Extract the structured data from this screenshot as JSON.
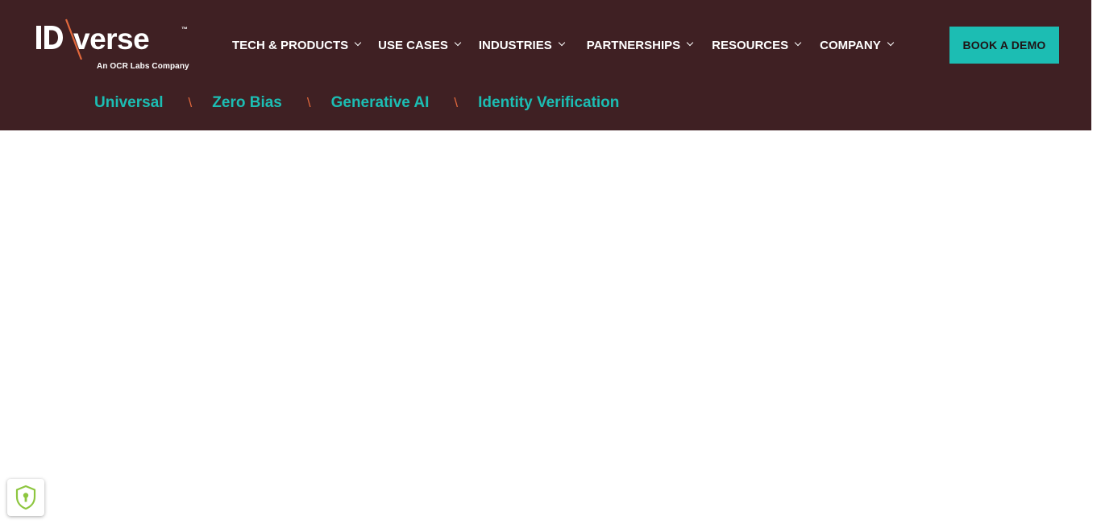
{
  "logo": {
    "wordmark": "IDVerse",
    "trademark": "™",
    "tagline": "An OCR Labs Company"
  },
  "nav": {
    "items": [
      {
        "label": "TECH & PRODUCTS"
      },
      {
        "label": "USE CASES"
      },
      {
        "label": "INDUSTRIES"
      },
      {
        "label": "PARTNERSHIPS"
      },
      {
        "label": "RESOURCES"
      },
      {
        "label": "COMPANY"
      }
    ]
  },
  "cta": {
    "label": "BOOK A DEMO"
  },
  "subnav": {
    "links": [
      "Universal",
      "Zero Bias",
      "Generative AI",
      "Identity Verification"
    ],
    "separator": "\\"
  },
  "colors": {
    "header_bg": "#3f2023",
    "accent_teal": "#1cbdb3",
    "accent_orange": "#e2683c"
  },
  "privacy_badge": {
    "icon": "shield-lock-icon"
  }
}
